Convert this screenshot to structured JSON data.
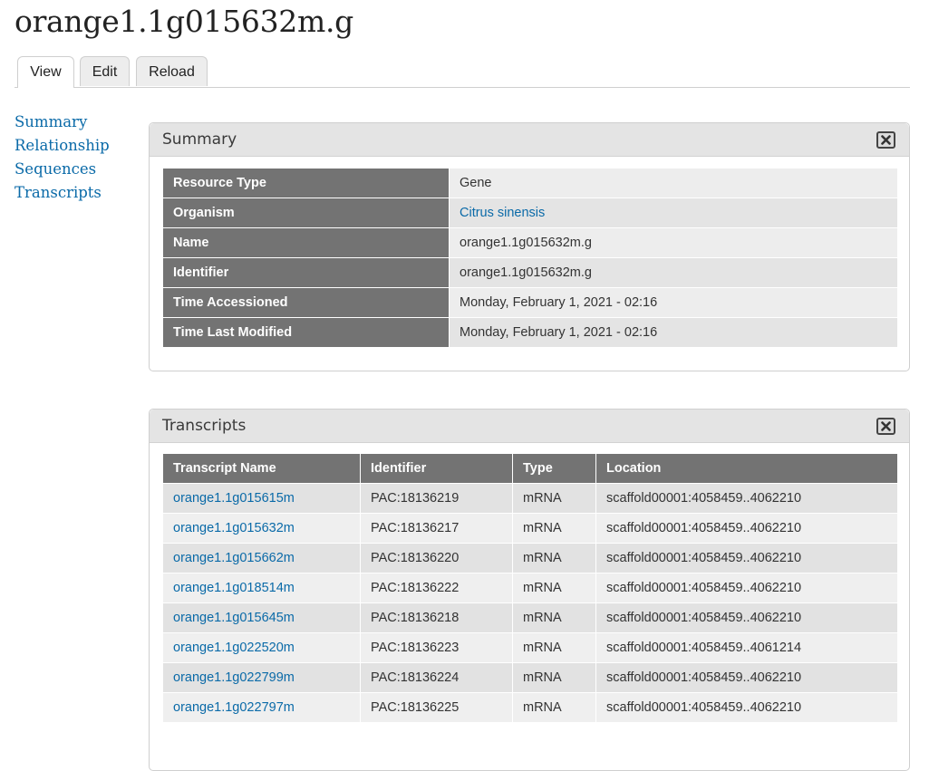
{
  "page": {
    "title": "orange1.1g015632m.g"
  },
  "tabs": [
    {
      "label": "View",
      "active": true
    },
    {
      "label": "Edit",
      "active": false
    },
    {
      "label": "Reload",
      "active": false
    }
  ],
  "sidebar": {
    "items": [
      {
        "label": "Summary"
      },
      {
        "label": "Relationship"
      },
      {
        "label": "Sequences"
      },
      {
        "label": "Transcripts"
      }
    ]
  },
  "summary": {
    "title": "Summary",
    "close_icon": "close-x-icon",
    "rows": [
      {
        "label": "Resource Type",
        "value": "Gene"
      },
      {
        "label": "Organism",
        "value": "Citrus sinensis"
      },
      {
        "label": "Name",
        "value": "orange1.1g015632m.g"
      },
      {
        "label": "Identifier",
        "value": "orange1.1g015632m.g"
      },
      {
        "label": "Time Accessioned",
        "value": "Monday, February 1, 2021 - 02:16"
      },
      {
        "label": "Time Last Modified",
        "value": "Monday, February 1, 2021 - 02:16"
      }
    ]
  },
  "transcripts": {
    "title": "Transcripts",
    "close_icon": "close-x-icon",
    "columns": [
      "Transcript Name",
      "Identifier",
      "Type",
      "Location"
    ],
    "rows": [
      {
        "name": "orange1.1g015615m",
        "identifier": "PAC:18136219",
        "type": "mRNA",
        "location": "scaffold00001:4058459..4062210"
      },
      {
        "name": "orange1.1g015632m",
        "identifier": "PAC:18136217",
        "type": "mRNA",
        "location": "scaffold00001:4058459..4062210"
      },
      {
        "name": "orange1.1g015662m",
        "identifier": "PAC:18136220",
        "type": "mRNA",
        "location": "scaffold00001:4058459..4062210"
      },
      {
        "name": "orange1.1g018514m",
        "identifier": "PAC:18136222",
        "type": "mRNA",
        "location": "scaffold00001:4058459..4062210"
      },
      {
        "name": "orange1.1g015645m",
        "identifier": "PAC:18136218",
        "type": "mRNA",
        "location": "scaffold00001:4058459..4062210"
      },
      {
        "name": "orange1.1g022520m",
        "identifier": "PAC:18136223",
        "type": "mRNA",
        "location": "scaffold00001:4058459..4061214"
      },
      {
        "name": "orange1.1g022799m",
        "identifier": "PAC:18136224",
        "type": "mRNA",
        "location": "scaffold00001:4058459..4062210"
      },
      {
        "name": "orange1.1g022797m",
        "identifier": "PAC:18136225",
        "type": "mRNA",
        "location": "scaffold00001:4058459..4062210"
      }
    ]
  },
  "colors": {
    "link": "#0a6aa8",
    "header_cell": "#737373",
    "pane_header": "#e4e4e4"
  }
}
